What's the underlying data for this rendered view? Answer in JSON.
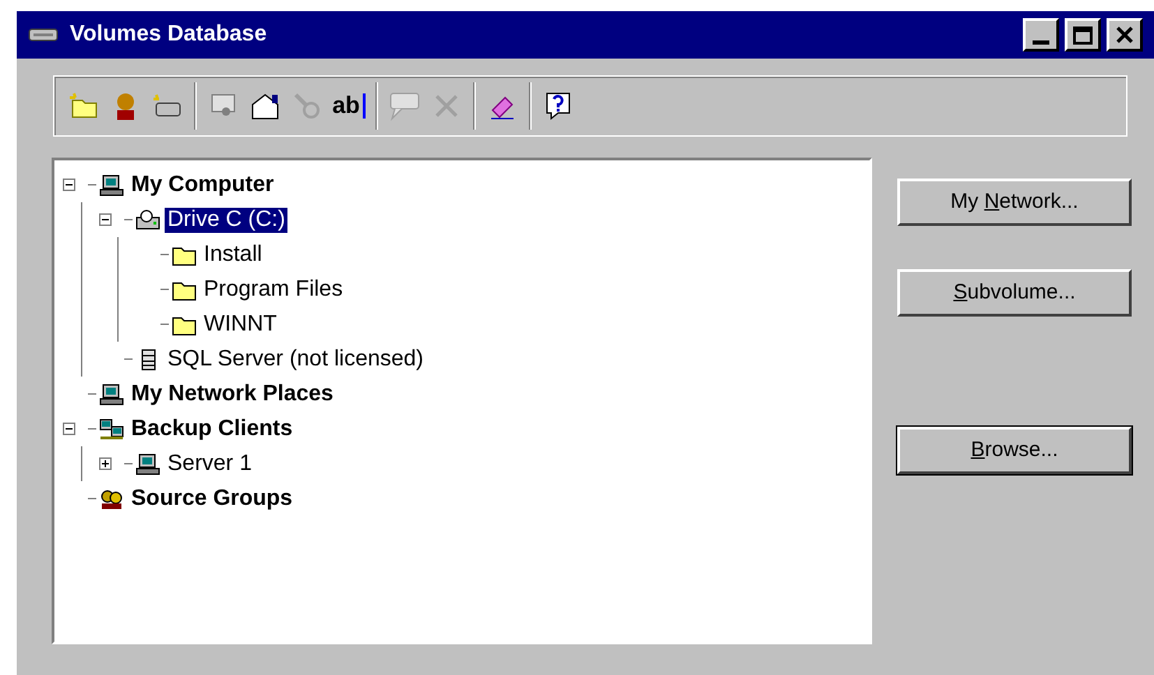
{
  "window": {
    "title": "Volumes Database"
  },
  "toolbar": {
    "rename_label": "ab"
  },
  "tree": [
    {
      "label": "My Computer",
      "kind": "computer",
      "bold": true,
      "selected": false,
      "expanded": true,
      "children": [
        {
          "label": "Drive C (C:)",
          "kind": "drive",
          "bold": false,
          "selected": true,
          "expanded": true,
          "children": [
            {
              "label": "Install",
              "kind": "folder",
              "bold": false,
              "selected": false
            },
            {
              "label": "Program Files",
              "kind": "folder",
              "bold": false,
              "selected": false
            },
            {
              "label": "WINNT",
              "kind": "folder",
              "bold": false,
              "selected": false
            }
          ]
        },
        {
          "label": "SQL Server (not licensed)",
          "kind": "server",
          "bold": false,
          "selected": false
        }
      ]
    },
    {
      "label": "My Network Places",
      "kind": "computer",
      "bold": true,
      "selected": false
    },
    {
      "label": "Backup Clients",
      "kind": "clients",
      "bold": true,
      "selected": false,
      "expanded": true,
      "children": [
        {
          "label": "Server 1",
          "kind": "computer",
          "bold": false,
          "selected": false,
          "expanded": false
        }
      ]
    },
    {
      "label": "Source Groups",
      "kind": "groups",
      "bold": true,
      "selected": false
    }
  ],
  "buttons": [
    {
      "before": "My ",
      "key": "N",
      "after": "etwork...",
      "default": false
    },
    {
      "key": "S",
      "after": "ubvolume...",
      "default": false
    },
    {
      "key": "B",
      "after": "rowse...",
      "default": true
    }
  ]
}
